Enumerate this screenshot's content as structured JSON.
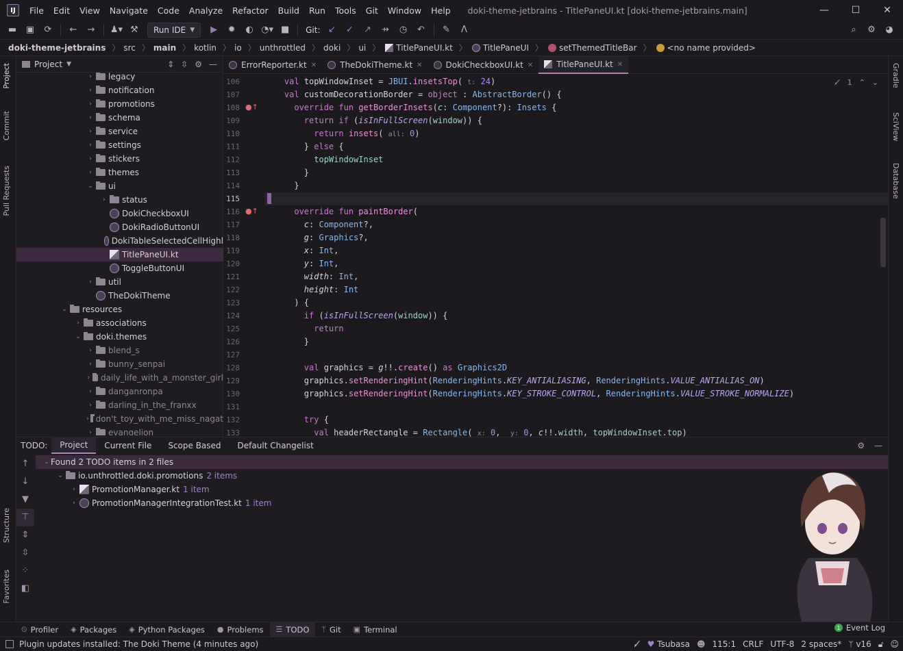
{
  "menubar": {
    "items": [
      "File",
      "Edit",
      "View",
      "Navigate",
      "Code",
      "Analyze",
      "Refactor",
      "Build",
      "Run",
      "Tools",
      "Git",
      "Window",
      "Help"
    ],
    "window_title": "doki-theme-jetbrains - TitlePaneUI.kt [doki-theme-jetbrains.main]",
    "logo_text": "IJ"
  },
  "toolbar": {
    "run_config": "Run IDE",
    "git_label": "Git:"
  },
  "breadcrumb": [
    "doki-theme-jetbrains",
    "src",
    "main",
    "kotlin",
    "io",
    "unthrottled",
    "doki",
    "ui",
    "TitlePaneUI.kt",
    "TitlePaneUI",
    "setThemedTitleBar",
    "<no name provided>"
  ],
  "left_tabs": [
    "Project",
    "Commit",
    "Pull Requests",
    "Structure",
    "Favorites"
  ],
  "right_tabs": [
    "Gradle",
    "SciView",
    "Database"
  ],
  "project": {
    "header": "Project",
    "rows": [
      {
        "label": "legacy",
        "type": "folder",
        "indent": 1,
        "chev": "›"
      },
      {
        "label": "notification",
        "type": "folder",
        "indent": 1,
        "chev": "›"
      },
      {
        "label": "promotions",
        "type": "folder",
        "indent": 1,
        "chev": "›"
      },
      {
        "label": "schema",
        "type": "folder",
        "indent": 1,
        "chev": "›"
      },
      {
        "label": "service",
        "type": "folder",
        "indent": 1,
        "chev": "›"
      },
      {
        "label": "settings",
        "type": "folder",
        "indent": 1,
        "chev": "›"
      },
      {
        "label": "stickers",
        "type": "folder",
        "indent": 1,
        "chev": "›"
      },
      {
        "label": "themes",
        "type": "folder",
        "indent": 1,
        "chev": "›"
      },
      {
        "label": "ui",
        "type": "folder",
        "indent": 1,
        "chev": "⌄"
      },
      {
        "label": "status",
        "type": "folder",
        "indent": 2,
        "chev": "›"
      },
      {
        "label": "DokiCheckboxUI",
        "type": "kt",
        "indent": 2,
        "chev": ""
      },
      {
        "label": "DokiRadioButtonUI",
        "type": "kt",
        "indent": 2,
        "chev": ""
      },
      {
        "label": "DokiTableSelectedCellHighl",
        "type": "kt",
        "indent": 2,
        "chev": ""
      },
      {
        "label": "TitlePaneUI.kt",
        "type": "ktf",
        "indent": 2,
        "chev": "",
        "selected": true
      },
      {
        "label": "ToggleButtonUI",
        "type": "kt",
        "indent": 2,
        "chev": ""
      },
      {
        "label": "util",
        "type": "folder",
        "indent": 1,
        "chev": "›"
      },
      {
        "label": "TheDokiTheme",
        "type": "kt",
        "indent": 1,
        "chev": ""
      },
      {
        "label": "resources",
        "type": "folder",
        "indent": -1,
        "chev": "⌄"
      },
      {
        "label": "associations",
        "type": "folder",
        "indent": 0,
        "chev": "›"
      },
      {
        "label": "doki.themes",
        "type": "folder",
        "indent": 0,
        "chev": "⌄"
      },
      {
        "label": "blend_s",
        "type": "folder",
        "indent": 1,
        "chev": "›",
        "muted": true
      },
      {
        "label": "bunny_senpai",
        "type": "folder",
        "indent": 1,
        "chev": "›",
        "muted": true
      },
      {
        "label": "daily_life_with_a_monster_girl",
        "type": "folder",
        "indent": 1,
        "chev": "›",
        "muted": true
      },
      {
        "label": "danganronpa",
        "type": "folder",
        "indent": 1,
        "chev": "›",
        "muted": true
      },
      {
        "label": "darling_in_the_franxx",
        "type": "folder",
        "indent": 1,
        "chev": "›",
        "muted": true
      },
      {
        "label": "don't_toy_with_me_miss_nagat",
        "type": "folder",
        "indent": 1,
        "chev": "›",
        "muted": true
      },
      {
        "label": "evangelion",
        "type": "folder",
        "indent": 1,
        "chev": "›",
        "muted": true
      }
    ]
  },
  "tabs": [
    {
      "label": "ErrorReporter.kt",
      "icon": "kt"
    },
    {
      "label": "TheDokiTheme.kt",
      "icon": "kt"
    },
    {
      "label": "DokiCheckboxUI.kt",
      "icon": "kt"
    },
    {
      "label": "TitlePaneUI.kt",
      "icon": "ktf",
      "active": true
    }
  ],
  "editor": {
    "inspection_count": "1"
  },
  "code": [
    {
      "n": "106",
      "html": "    <span class='kw'>val</span> topWindowInset = <span class='ty'>JBUI</span>.<span class='fn'>insetsTop</span>( <span class='hint'>t:</span> <span class='nm'>24</span>)"
    },
    {
      "n": "107",
      "html": "    <span class='kw'>val</span> customDecorationBorder = <span class='kw'>object</span> : <span class='ty'>AbstractBorder</span>() {"
    },
    {
      "n": "108",
      "html": "      <span class='kw'>override fun</span> <span class='fn'>getBorderInsets</span>(<span class='it pr'>c</span>: <span class='ty'>Component</span>?): <span class='ty'>Insets</span> {",
      "ovr": true
    },
    {
      "n": "109",
      "html": "        <span class='kw'>return if</span> (<span class='cn'>isInFullScreen</span>(<span class='pr'>window</span>)) {"
    },
    {
      "n": "110",
      "html": "          <span class='kw'>return</span> <span class='fn'>insets</span>( <span class='hint'>all:</span> <span class='nm'>0</span>)"
    },
    {
      "n": "111",
      "html": "        } <span class='kw'>else</span> {"
    },
    {
      "n": "112",
      "html": "          <span class='pr'>topWindowInset</span>"
    },
    {
      "n": "113",
      "html": "        }"
    },
    {
      "n": "114",
      "html": "      }"
    },
    {
      "n": "115",
      "html": "",
      "cur": true
    },
    {
      "n": "116",
      "html": "      <span class='kw'>override fun</span> <span class='fn'>paintBorder</span>(",
      "ovr": true
    },
    {
      "n": "117",
      "html": "        <span class='it'>c</span>: <span class='ty'>Component</span>?,"
    },
    {
      "n": "118",
      "html": "        <span class='it'>g</span>: <span class='ty'>Graphics</span>?,"
    },
    {
      "n": "119",
      "html": "        <span class='it'>x</span>: <span class='ty'>Int</span>,"
    },
    {
      "n": "120",
      "html": "        <span class='it'>y</span>: <span class='ty'>Int</span>,"
    },
    {
      "n": "121",
      "html": "        <span class='it'>width</span>: <span class='ty'>Int</span>,"
    },
    {
      "n": "122",
      "html": "        <span class='it'>height</span>: <span class='ty'>Int</span>"
    },
    {
      "n": "123",
      "html": "      ) {"
    },
    {
      "n": "124",
      "html": "        <span class='kw'>if</span> (<span class='cn'>isInFullScreen</span>(<span class='pr'>window</span>)) {"
    },
    {
      "n": "125",
      "html": "          <span class='kw'>return</span>"
    },
    {
      "n": "126",
      "html": "        }"
    },
    {
      "n": "127",
      "html": ""
    },
    {
      "n": "128",
      "html": "        <span class='kw'>val</span> graphics = <span class='it'>g</span>!!.<span class='fn'>create</span>() <span class='kw'>as</span> <span class='ty'>Graphics2D</span>"
    },
    {
      "n": "129",
      "html": "        graphics.<span class='fn'>setRenderingHint</span>(<span class='ty'>RenderingHints</span>.<span class='cn'>KEY_ANTIALIASING</span>, <span class='ty'>RenderingHints</span>.<span class='cn'>VALUE_ANTIALIAS_ON</span>)"
    },
    {
      "n": "130",
      "html": "        graphics.<span class='fn'>setRenderingHint</span>(<span class='ty'>RenderingHints</span>.<span class='cn'>KEY_STROKE_CONTROL</span>, <span class='ty'>RenderingHints</span>.<span class='cn'>VALUE_STROKE_NORMALIZE</span>)"
    },
    {
      "n": "131",
      "html": ""
    },
    {
      "n": "132",
      "html": "        <span class='kw'>try</span> {"
    },
    {
      "n": "133",
      "html": "          <span class='kw'>val</span> headerRectangle = <span class='ty'>Rectangle</span>( <span class='hint'>x:</span> <span class='nm'>0</span>,  <span class='hint'>y:</span> <span class='nm'>0</span>, <span class='it'>c</span>!!.<span class='pr'>width</span>, <span class='pr'>topWindowInset</span>.<span class='pr'>top</span>)"
    }
  ],
  "todo": {
    "label": "TODO:",
    "tabs": [
      "Project",
      "Current File",
      "Scope Based",
      "Default Changelist"
    ],
    "rows": [
      {
        "text": "Found 2 TODO items in 2 files",
        "count": "",
        "chev": "⌄",
        "indent": 0,
        "icon": "",
        "hl": true
      },
      {
        "text": "io.unthrottled.doki.promotions",
        "count": "2 items",
        "chev": "⌄",
        "indent": 1,
        "icon": "folder"
      },
      {
        "text": "PromotionManager.kt",
        "count": "1 item",
        "chev": "›",
        "indent": 2,
        "icon": "ktf"
      },
      {
        "text": "PromotionManagerIntegrationTest.kt",
        "count": "1 item",
        "chev": "›",
        "indent": 2,
        "icon": "kt"
      }
    ]
  },
  "bottom_tabs": [
    {
      "label": "Profiler",
      "icon": "⏲"
    },
    {
      "label": "Packages",
      "icon": "◈"
    },
    {
      "label": "Python Packages",
      "icon": "◈"
    },
    {
      "label": "Problems",
      "icon": "●"
    },
    {
      "label": "TODO",
      "icon": "☰",
      "active": true
    },
    {
      "label": "Git",
      "icon": "ᛘ"
    },
    {
      "label": "Terminal",
      "icon": "▣"
    }
  ],
  "event_log": {
    "count": "1",
    "label": "Event Log"
  },
  "status": {
    "message": "Plugin updates installed: The Doki Theme (4 minutes ago)",
    "theme": "Tsubasa",
    "position": "115:1",
    "line_sep": "CRLF",
    "encoding": "UTF-8",
    "indent": "2 spaces*",
    "branch": "v16"
  }
}
